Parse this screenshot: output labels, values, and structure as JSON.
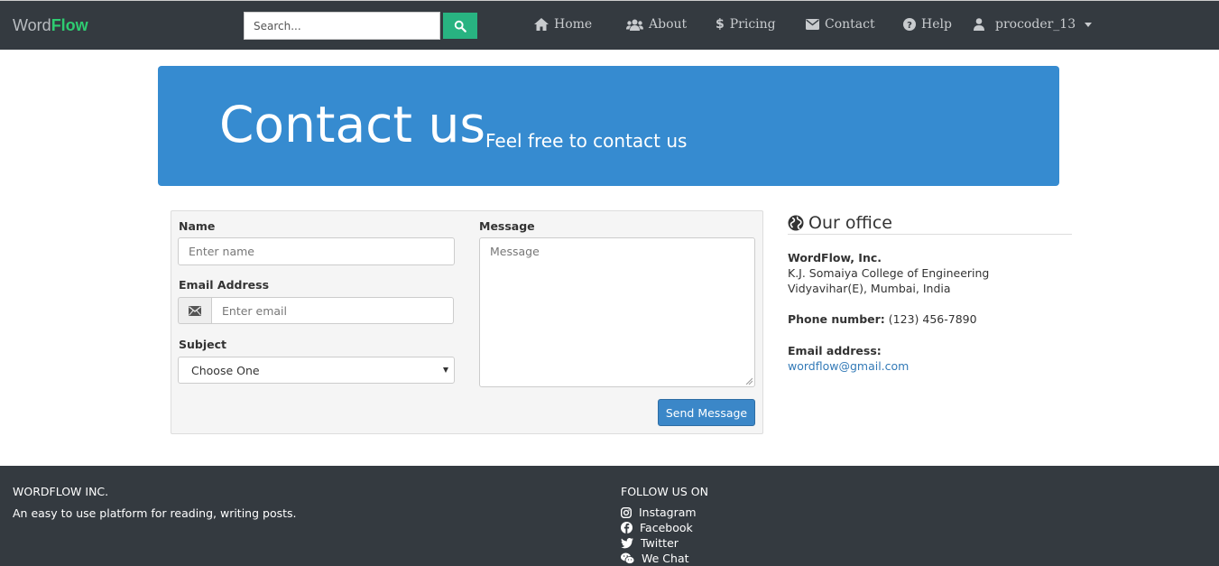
{
  "navbar": {
    "brand_prefix": "Word",
    "brand_suffix": "Flow",
    "search_placeholder": "Search...",
    "search_icon": "search-icon",
    "items": [
      {
        "label": "Home",
        "icon": "home-icon"
      },
      {
        "label": "About",
        "icon": "users-icon"
      },
      {
        "label": "Pricing",
        "icon": "dollar-icon"
      },
      {
        "label": "Contact",
        "icon": "envelope-icon"
      },
      {
        "label": "Help",
        "icon": "question-circle-icon"
      }
    ],
    "user": {
      "label": "procoder_13",
      "icon": "user-icon"
    }
  },
  "jumbotron": {
    "title": "Contact us",
    "subtitle": "Feel free to contact us"
  },
  "form": {
    "name_label": "Name",
    "name_placeholder": "Enter name",
    "email_label": "Email Address",
    "email_placeholder": "Enter email",
    "subject_label": "Subject",
    "subject_value": "Choose One",
    "message_label": "Message",
    "message_placeholder": "Message",
    "send_label": "Send Message"
  },
  "office": {
    "title": "Our office",
    "company": "WordFlow, Inc.",
    "address_line1": "K.J. Somaiya College of Engineering",
    "address_line2": "Vidyavihar(E), Mumbai, India",
    "phone_label": "Phone number:",
    "phone_value": "(123) 456-7890",
    "email_label": "Email address:",
    "email_value": "wordflow@gmail.com"
  },
  "footer": {
    "company_heading": "WORDFLOW INC.",
    "company_text": "An easy to use platform for reading, writing posts.",
    "follow_heading": "FOLLOW US ON",
    "social": [
      {
        "label": "Instagram",
        "icon": "instagram-icon"
      },
      {
        "label": "Facebook",
        "icon": "facebook-icon"
      },
      {
        "label": "Twitter",
        "icon": "twitter-icon"
      },
      {
        "label": "We Chat",
        "icon": "wechat-icon"
      }
    ]
  },
  "colors": {
    "navbar_bg": "#343a40",
    "brand_accent": "#2ecc71",
    "search_button": "#28b381",
    "jumbotron_bg": "#368bd0",
    "send_button": "#3b87c8",
    "link": "#337ab7"
  }
}
